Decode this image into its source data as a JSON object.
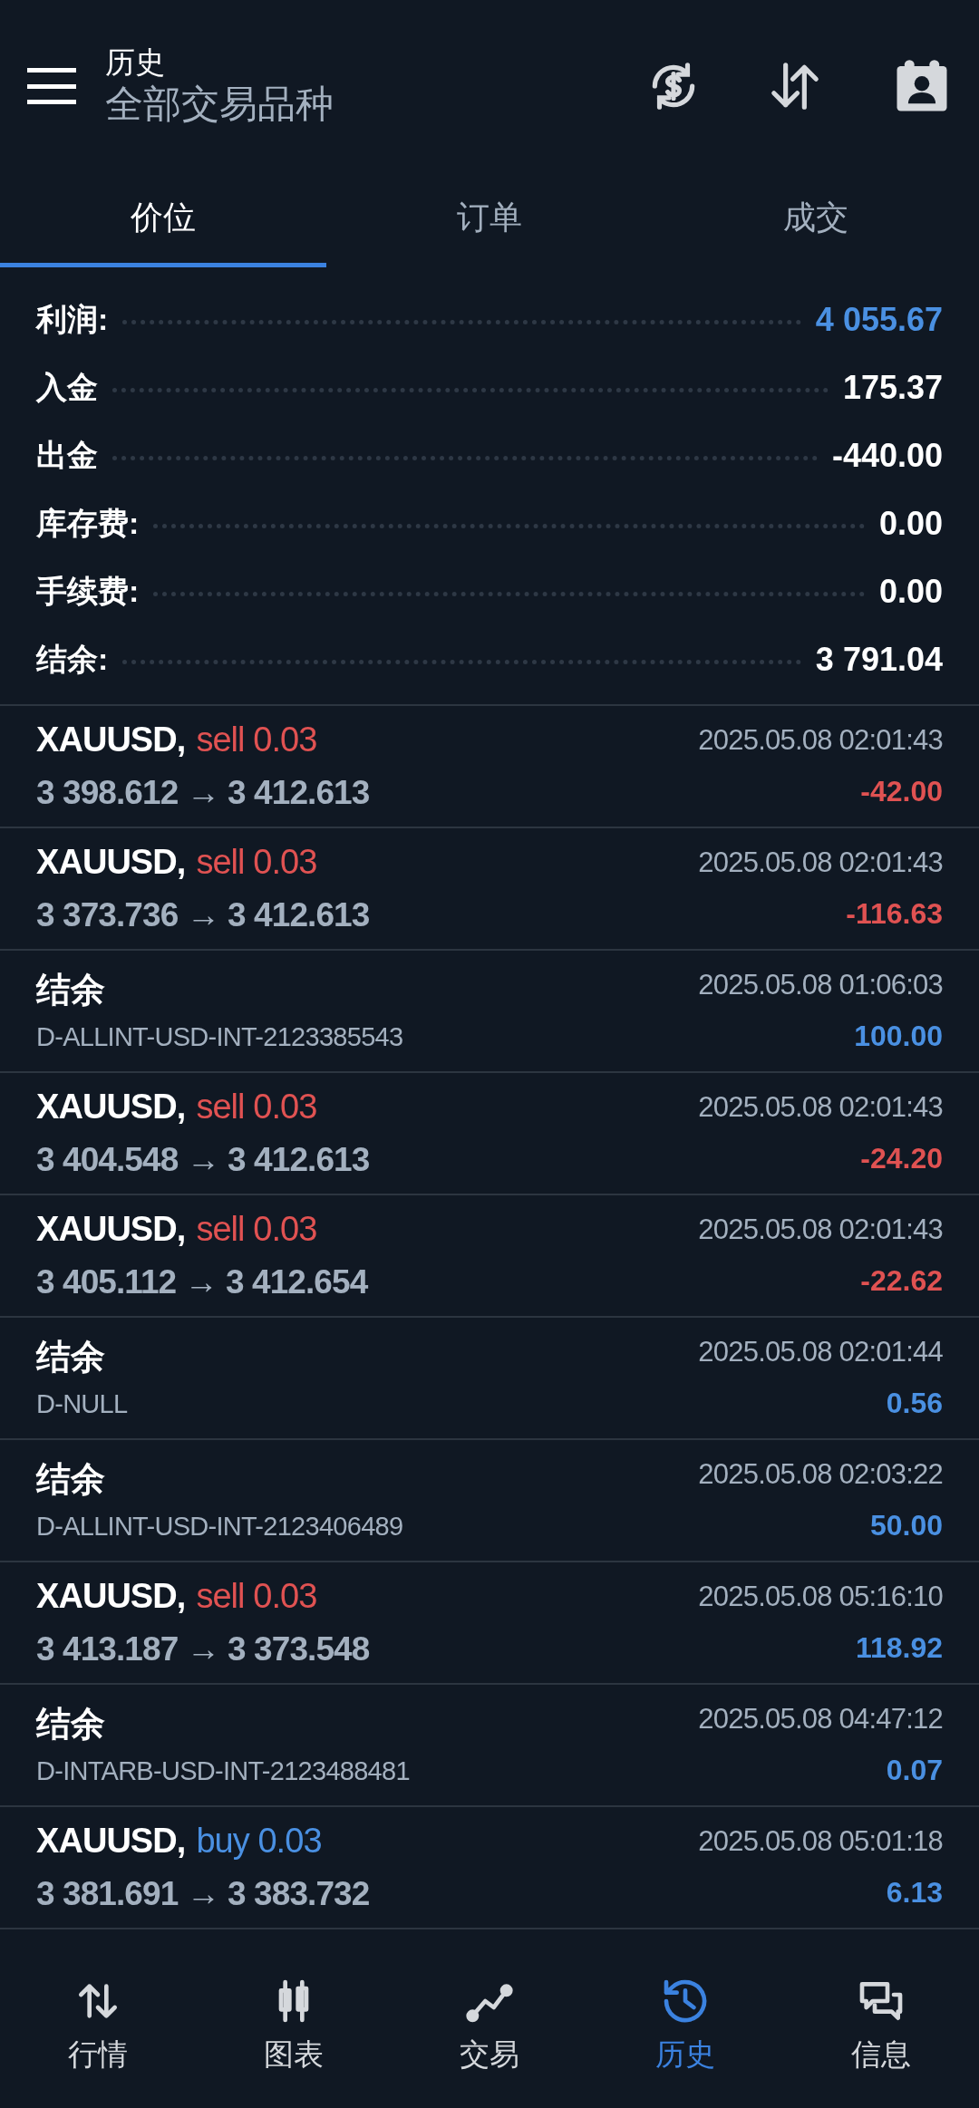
{
  "header": {
    "title": "历史",
    "subtitle": "全部交易品种"
  },
  "tabs": [
    {
      "label": "价位",
      "selected": true
    },
    {
      "label": "订单",
      "selected": false
    },
    {
      "label": "成交",
      "selected": false
    }
  ],
  "summary": [
    {
      "label": "利润:",
      "value": "4 055.67",
      "highlight": true
    },
    {
      "label": "入金",
      "value": "175.37",
      "highlight": false
    },
    {
      "label": "出金",
      "value": "-440.00",
      "highlight": false
    },
    {
      "label": "库存费:",
      "value": "0.00",
      "highlight": false
    },
    {
      "label": "手续费:",
      "value": "0.00",
      "highlight": false
    },
    {
      "label": "结余:",
      "value": "3 791.04",
      "highlight": false
    }
  ],
  "deals": [
    {
      "kind": "trade",
      "symbol": "XAUUSD,",
      "type_label": "sell 0.03",
      "color": "#e05252",
      "prices": "3 398.612 → 3 412.613",
      "time": "2025.05.08 02:01:43",
      "profit": "-42.00",
      "profit_positive": false
    },
    {
      "kind": "trade",
      "symbol": "XAUUSD,",
      "type_label": "sell 0.03",
      "color": "#e05252",
      "prices": "3 373.736 → 3 412.613",
      "time": "2025.05.08 02:01:43",
      "profit": "-116.63",
      "profit_positive": false
    },
    {
      "kind": "balance",
      "symbol": "结余",
      "comment": "D-ALLINT-USD-INT-2123385543",
      "time": "2025.05.08 01:06:03",
      "profit": "100.00",
      "profit_positive": true
    },
    {
      "kind": "trade",
      "symbol": "XAUUSD,",
      "type_label": "sell 0.03",
      "color": "#e05252",
      "prices": "3 404.548 → 3 412.613",
      "time": "2025.05.08 02:01:43",
      "profit": "-24.20",
      "profit_positive": false
    },
    {
      "kind": "trade",
      "symbol": "XAUUSD,",
      "type_label": "sell 0.03",
      "color": "#e05252",
      "prices": "3 405.112 → 3 412.654",
      "time": "2025.05.08 02:01:43",
      "profit": "-22.62",
      "profit_positive": false
    },
    {
      "kind": "balance",
      "symbol": "结余",
      "comment": "D-NULL",
      "time": "2025.05.08 02:01:44",
      "profit": "0.56",
      "profit_positive": true
    },
    {
      "kind": "balance",
      "symbol": "结余",
      "comment": "D-ALLINT-USD-INT-2123406489",
      "time": "2025.05.08 02:03:22",
      "profit": "50.00",
      "profit_positive": true
    },
    {
      "kind": "trade",
      "symbol": "XAUUSD,",
      "type_label": "sell 0.03",
      "color": "#e05252",
      "prices": "3 413.187 → 3 373.548",
      "time": "2025.05.08 05:16:10",
      "profit": "118.92",
      "profit_positive": true
    },
    {
      "kind": "balance",
      "symbol": "结余",
      "comment": "D-INTARB-USD-INT-2123488481",
      "time": "2025.05.08 04:47:12",
      "profit": "0.07",
      "profit_positive": true
    },
    {
      "kind": "trade",
      "symbol": "XAUUSD,",
      "type_label": "buy 0.03",
      "color": "#4a90e2",
      "prices": "3 381.691 → 3 383.732",
      "time": "2025.05.08 05:01:18",
      "profit": "6.13",
      "profit_positive": true
    }
  ],
  "nav": [
    {
      "label": "行情",
      "selected": false
    },
    {
      "label": "图表",
      "selected": false
    },
    {
      "label": "交易",
      "selected": false
    },
    {
      "label": "历史",
      "selected": true
    },
    {
      "label": "信息",
      "selected": false
    }
  ]
}
